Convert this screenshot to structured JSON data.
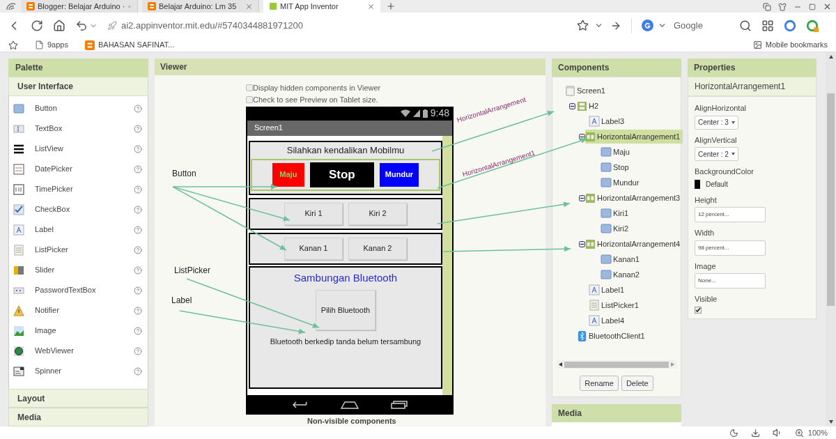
{
  "browser": {
    "tabs": [
      {
        "title": "Blogger: Belajar Arduino ·",
        "selected": false
      },
      {
        "title": "Belajar Arduino: Lm 35",
        "selected": false
      },
      {
        "title": "MIT App Inventor",
        "selected": true
      }
    ],
    "address": "ai2.appinventor.mit.edu/#5740344881971200",
    "search_engine": "Google",
    "bookmarks": [
      {
        "kind": "page",
        "title": "9apps"
      },
      {
        "kind": "blogger",
        "title": "BAHASAN SAFINAT..."
      }
    ],
    "mobile_bookmarks": "Mobile bookmarks",
    "zoom": "100%"
  },
  "palette": {
    "title": "Palette",
    "section": "User Interface",
    "items": [
      {
        "kind": "button",
        "label": "Button"
      },
      {
        "kind": "textbox",
        "label": "TextBox"
      },
      {
        "kind": "listview",
        "label": "ListView"
      },
      {
        "kind": "datepicker",
        "label": "DatePicker"
      },
      {
        "kind": "timepicker",
        "label": "TimePicker"
      },
      {
        "kind": "checkbox",
        "label": "CheckBox"
      },
      {
        "kind": "label",
        "label": "Label"
      },
      {
        "kind": "listpicker",
        "label": "ListPicker"
      },
      {
        "kind": "slider",
        "label": "Slider"
      },
      {
        "kind": "password",
        "label": "PasswordTextBox"
      },
      {
        "kind": "notifier",
        "label": "Notifier"
      },
      {
        "kind": "image",
        "label": "Image"
      },
      {
        "kind": "webviewer",
        "label": "WebViewer"
      },
      {
        "kind": "spinner",
        "label": "Spinner"
      }
    ],
    "sections": [
      "Layout",
      "Media"
    ]
  },
  "viewer": {
    "title": "Viewer",
    "options": [
      {
        "label": "Display hidden components in Viewer",
        "checked": false
      },
      {
        "label": "Check to see Preview on Tablet size.",
        "checked": false
      }
    ],
    "phone": {
      "time": "9:48",
      "title": "Screen1",
      "heading": "Silahkan kendalikan Mobilmu",
      "rows": [
        {
          "selected": true,
          "buttons": [
            {
              "text": "Maju",
              "color": "#ff0000",
              "label": {
                "color": "#8fcf6a"
              }
            },
            {
              "text": "Stop",
              "color": "#000000",
              "label": {
                "color": "#ffffff"
              }
            },
            {
              "text": "Mundur",
              "color": "#0000ff",
              "label": {
                "color": "#ffffff"
              }
            }
          ]
        },
        {
          "selected": false,
          "buttons": [
            {
              "text": "Kiri 1"
            },
            {
              "text": "Kiri 2"
            }
          ]
        },
        {
          "selected": false,
          "buttons": [
            {
              "text": "Kanan 1"
            },
            {
              "text": "Kanan 2"
            }
          ]
        }
      ],
      "bluetooth_title": "Sambungan Bluetooth",
      "picker": "Pilih Bluetooth",
      "status": "Bluetooth berkedip tanda belum tersambung"
    },
    "non_visible": "Non-visible components"
  },
  "annotations": {
    "left": [
      "Button",
      "ListPicker",
      "Label"
    ],
    "right": [
      "HorizontalArrangement",
      "HorizontalArrangement1"
    ]
  },
  "components": {
    "title": "Components",
    "tree": [
      {
        "name": "Screen1",
        "kind": "screen",
        "selected": false,
        "children": [
          {
            "name": "H2",
            "kind": "vertical",
            "selected": false,
            "expanded": true,
            "children": [
              {
                "name": "Label3",
                "kind": "label",
                "selected": false
              },
              {
                "name": "HorizontalArrangement1",
                "kind": "horizontal",
                "selected": true,
                "expanded": true,
                "children": [
                  {
                    "name": "Maju",
                    "kind": "button",
                    "selected": false
                  },
                  {
                    "name": "Stop",
                    "kind": "button",
                    "selected": false
                  },
                  {
                    "name": "Mundur",
                    "kind": "button",
                    "selected": false
                  }
                ]
              },
              {
                "name": "HorizontalArrangement3",
                "kind": "horizontal",
                "selected": false,
                "expanded": true,
                "children": [
                  {
                    "name": "Kiri1",
                    "kind": "button",
                    "selected": false
                  },
                  {
                    "name": "Kiri2",
                    "kind": "button",
                    "selected": false
                  }
                ]
              },
              {
                "name": "HorizontalArrangement4",
                "kind": "horizontal",
                "selected": false,
                "expanded": true,
                "children": [
                  {
                    "name": "Kanan1",
                    "kind": "button",
                    "selected": false
                  },
                  {
                    "name": "Kanan2",
                    "kind": "button",
                    "selected": false
                  }
                ]
              },
              {
                "name": "Label1",
                "kind": "label",
                "selected": false
              },
              {
                "name": "ListPicker1",
                "kind": "listpicker",
                "selected": false
              },
              {
                "name": "Label4",
                "kind": "label",
                "selected": false
              }
            ]
          },
          {
            "name": "BluetoothClient1",
            "kind": "bluetooth",
            "selected": false
          }
        ]
      }
    ],
    "buttons": [
      "Rename",
      "Delete"
    ],
    "media": "Media"
  },
  "properties": {
    "title": "Properties",
    "component": "HorizontalArrangement1",
    "fields": [
      {
        "kind": "dropdown",
        "label": "AlignHorizontal",
        "value": "Center : 3"
      },
      {
        "kind": "dropdown",
        "label": "AlignVertical",
        "value": "Center : 2"
      },
      {
        "kind": "color",
        "label": "BackgroundColor",
        "value": "Default",
        "color": "#000000"
      },
      {
        "kind": "text",
        "label": "Height",
        "value": "12 percent..."
      },
      {
        "kind": "text",
        "label": "Width",
        "value": "98 percent..."
      },
      {
        "kind": "text",
        "label": "Image",
        "value": "None..."
      },
      {
        "kind": "checkbox",
        "label": "Visible",
        "checked": true
      }
    ]
  }
}
